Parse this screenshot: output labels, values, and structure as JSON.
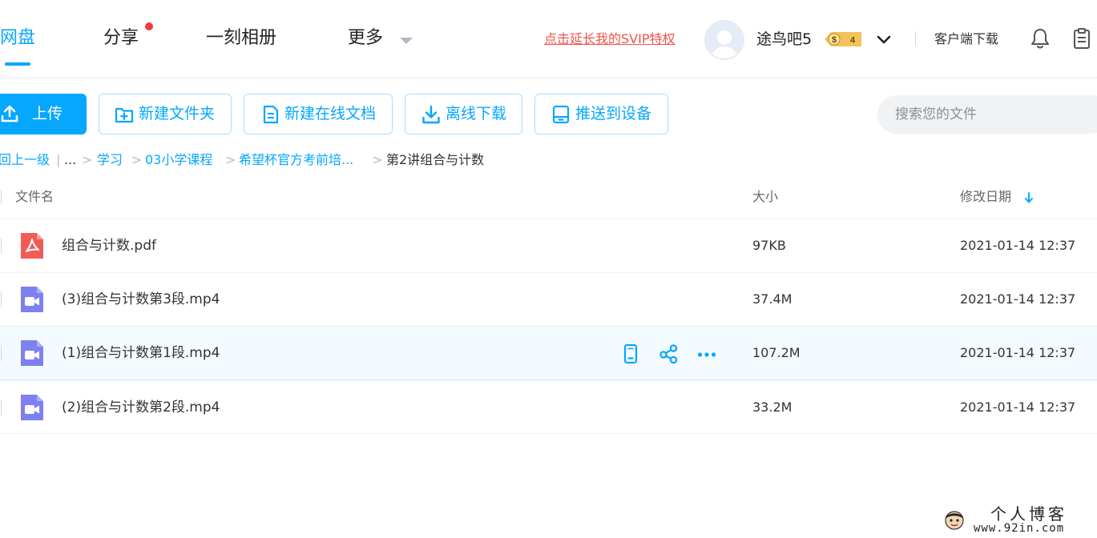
{
  "nav": {
    "tabs": [
      {
        "label": "网盘",
        "active": true
      },
      {
        "label": "分享",
        "has_dot": true
      },
      {
        "label": "一刻相册"
      },
      {
        "label": "更多"
      }
    ],
    "svip_link": "点击延长我的SVIP特权",
    "username": "途鸟吧5",
    "vip_level": "4",
    "vip_badge_symbol": "$",
    "client_download": "客户端下载",
    "icons": [
      "user-avatar",
      "vip-badge-icon",
      "chevron-down-icon",
      "bell-icon",
      "clipboard-icon"
    ]
  },
  "toolbar": {
    "upload": "上传",
    "new_folder": "新建文件夹",
    "new_doc": "新建在线文档",
    "offline_download": "离线下载",
    "push_device": "推送到设备"
  },
  "search": {
    "placeholder": "搜索您的文件"
  },
  "breadcrumb": {
    "back": "回上一级",
    "divider": "|",
    "ellipsis": "...",
    "sep": ">",
    "items": [
      "学习",
      "03小学课程",
      "希望杯官方考前培..."
    ],
    "current": "第2讲组合与计数"
  },
  "table": {
    "headers": {
      "name": "文件名",
      "size": "大小",
      "date": "修改日期"
    },
    "sort": {
      "column": "修改日期",
      "direction": "desc"
    },
    "rows": [
      {
        "name": "组合与计数.pdf",
        "size": "97KB",
        "date": "2021-01-14 12:37",
        "type": "pdf"
      },
      {
        "name": "(3)组合与计数第3段.mp4",
        "size": "37.4M",
        "date": "2021-01-14 12:37",
        "type": "video"
      },
      {
        "name": "(1)组合与计数第1段.mp4",
        "size": "107.2M",
        "date": "2021-01-14 12:37",
        "type": "video",
        "hovered": true
      },
      {
        "name": "(2)组合与计数第2段.mp4",
        "size": "33.2M",
        "date": "2021-01-14 12:37",
        "type": "video"
      }
    ],
    "row_actions": [
      "push-to-device-icon",
      "share-icon",
      "more-icon"
    ]
  },
  "watermark": {
    "title": "个人博客",
    "url": "www.92in.com"
  },
  "colors": {
    "accent": "#06a7ff",
    "svip_red": "#f05449",
    "pdf_red": "#f25b55",
    "video_purple": "#7e80f0",
    "badge_gold": "#f5c15a",
    "hover_row": "#f4fbff"
  }
}
